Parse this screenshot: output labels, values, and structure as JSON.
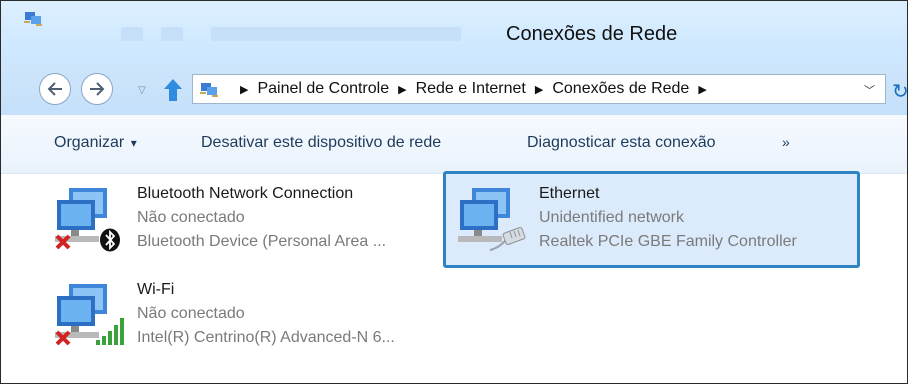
{
  "window": {
    "title": "Conexões de Rede"
  },
  "navigation": {
    "breadcrumbs": [
      "Painel de Controle",
      "Rede e Internet",
      "Conexões de Rede"
    ]
  },
  "toolbar": {
    "organize_label": "Organizar",
    "dropdown_glyph": "▾",
    "disable_label": "Desativar este dispositivo de rede",
    "diagnose_label": "Diagnosticar esta conexão",
    "more_glyph": "»"
  },
  "connections": [
    {
      "name": "Bluetooth Network Connection",
      "status": "Não conectado",
      "device": "Bluetooth Device (Personal Area ...",
      "status_icon": "red-x-icon",
      "adapter_icon": "bluetooth-icon",
      "selected": false
    },
    {
      "name": "Ethernet",
      "status": "Unidentified network",
      "device": "Realtek PCIe GBE Family Controller",
      "adapter_icon": "ethernet-cable-icon",
      "selected": true
    },
    {
      "name": "Wi-Fi",
      "status": "Não conectado",
      "device": "Intel(R) Centrino(R) Advanced-N 6...",
      "status_icon": "red-x-icon",
      "adapter_icon": "signal-bars-icon",
      "selected": false
    }
  ],
  "colors": {
    "selection_border": "#2e83c2",
    "selection_fill": "#dcebfc",
    "titlebar": "#cfe8ff"
  }
}
